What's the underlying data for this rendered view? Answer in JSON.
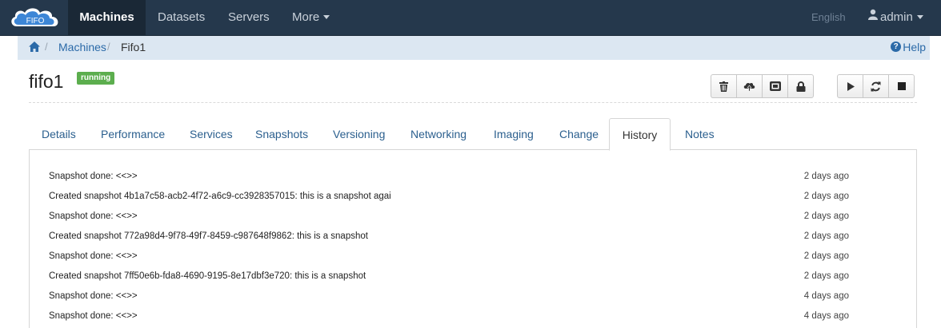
{
  "navbar": {
    "logo_text": "FIFO",
    "items": [
      {
        "label": "Machines"
      },
      {
        "label": "Datasets"
      },
      {
        "label": "Servers"
      },
      {
        "label": "More"
      }
    ],
    "language": "English",
    "user": "admin"
  },
  "breadcrumb": {
    "items": [
      {
        "label": "Machines"
      },
      {
        "label": "Fifo1"
      }
    ],
    "separator": "/",
    "help": "Help"
  },
  "machine": {
    "name": "fifo1",
    "status": "running"
  },
  "toolbar": {
    "group1": [
      "trash-icon",
      "cloud-upload-icon",
      "console-icon",
      "lock-icon"
    ],
    "group2": [
      "play-icon",
      "refresh-icon",
      "stop-icon"
    ]
  },
  "tabs": [
    {
      "label": "Details"
    },
    {
      "label": "Performance"
    },
    {
      "label": "Services"
    },
    {
      "label": "Snapshots"
    },
    {
      "label": "Versioning"
    },
    {
      "label": "Networking"
    },
    {
      "label": "Imaging"
    },
    {
      "label": "Change"
    },
    {
      "label": "History"
    },
    {
      "label": "Notes"
    }
  ],
  "history": [
    {
      "message": "Snapshot done: <<>>",
      "time": "2 days ago"
    },
    {
      "message": "Created snapshot 4b1a7c58-acb2-4f72-a6c9-cc3928357015: this is a snapshot agai",
      "time": "2 days ago"
    },
    {
      "message": "Snapshot done: <<>>",
      "time": "2 days ago"
    },
    {
      "message": "Created snapshot 772a98d4-9f78-49f7-8459-c987648f9862: this is a snapshot",
      "time": "2 days ago"
    },
    {
      "message": "Snapshot done: <<>>",
      "time": "2 days ago"
    },
    {
      "message": "Created snapshot 7ff50e6b-fda8-4690-9195-8e17dbf3e720: this is a snapshot",
      "time": "2 days ago"
    },
    {
      "message": "Snapshot done: <<>>",
      "time": "4 days ago"
    },
    {
      "message": "Snapshot done: <<>>",
      "time": "4 days ago"
    }
  ],
  "colors": {
    "navbar": "#25384c",
    "breadcrumb_bg": "#dce7f2",
    "link": "#2b6aa8",
    "status_running": "#5cae4e"
  }
}
